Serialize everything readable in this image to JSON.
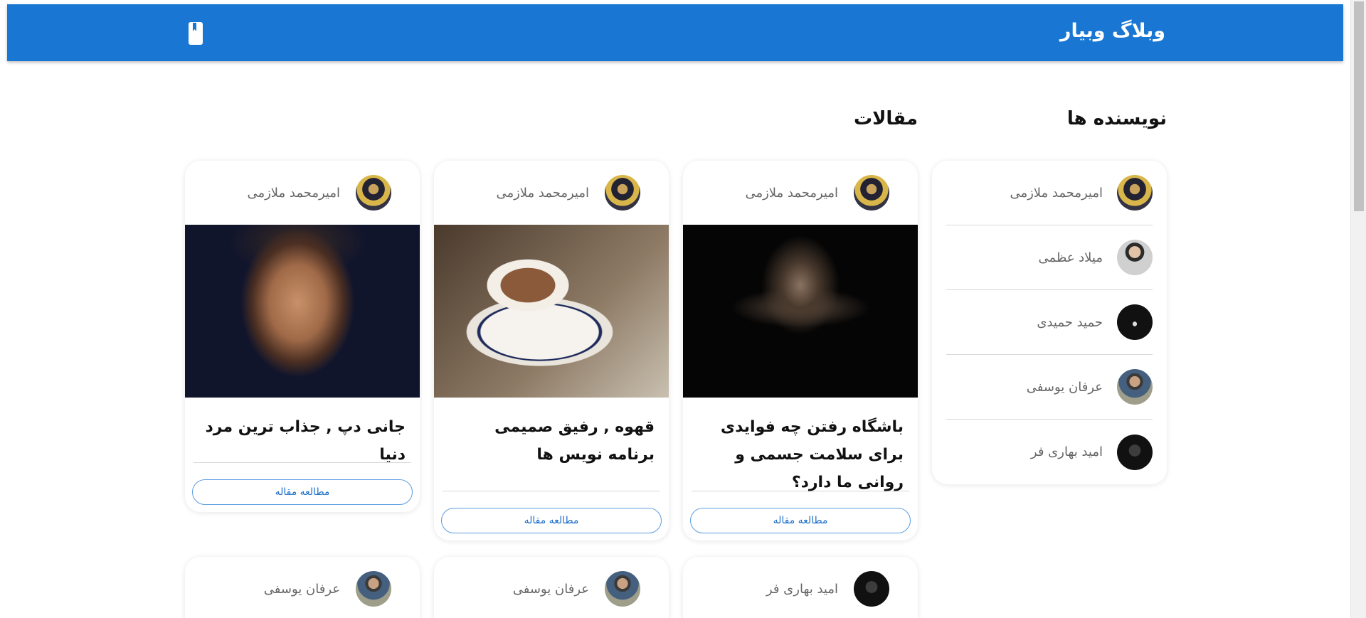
{
  "header": {
    "brand": "وبلاگ وبیار",
    "icon": "book-icon",
    "background": "#1976d2"
  },
  "sections": {
    "authors_title": "نویسنده ها",
    "articles_title": "مقالات"
  },
  "authors": [
    {
      "name": "امیرمحمد ملازمی"
    },
    {
      "name": "میلاد عظمی"
    },
    {
      "name": "حمید حمیدی"
    },
    {
      "name": "عرفان یوسفی"
    },
    {
      "name": "امید بهاری فر"
    }
  ],
  "articles": [
    {
      "author": "امیرمحمد ملازمی",
      "title": "باشگاه رفتن چه فوایدی برای سلامت جسمی و روانی ما دارد؟",
      "image": "gym-back-photo",
      "button": "مطالعه مقاله"
    },
    {
      "author": "امیرمحمد ملازمی",
      "title": "قهوه , رفیق صمیمی برنامه نویس ها",
      "image": "coffee-cup-photo",
      "button": "مطالعه مقاله"
    },
    {
      "author": "امیرمحمد ملازمی",
      "title": "جانی دپ , جذاب ترین مرد دنیا",
      "image": "johnny-depp-photo",
      "button": "مطالعه مقاله"
    },
    {
      "author": "امید بهاری فر"
    },
    {
      "author": "عرفان یوسفی"
    },
    {
      "author": "عرفان یوسفی"
    }
  ]
}
